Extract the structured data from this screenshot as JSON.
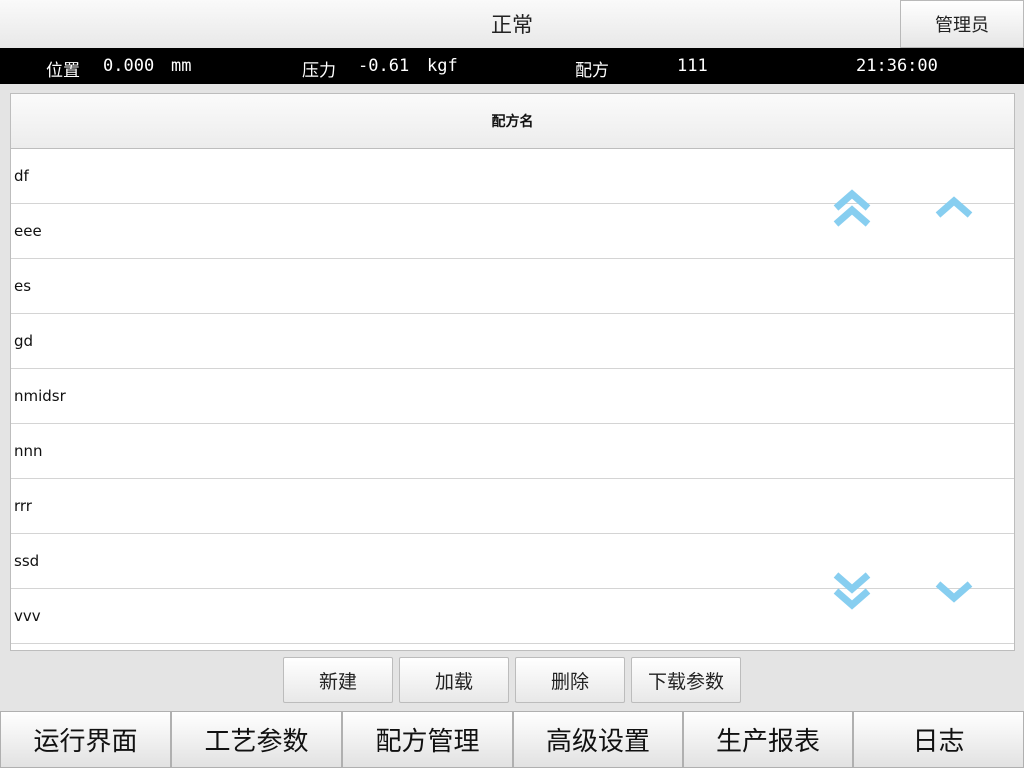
{
  "header": {
    "title": "正常",
    "user_button": "管理员"
  },
  "status": {
    "position_label": "位置",
    "position_value": "0.000",
    "position_unit": "mm",
    "pressure_label": "压力",
    "pressure_value": "-0.61",
    "pressure_unit": "kgf",
    "recipe_label": "配方",
    "recipe_value": "111",
    "time": "21:36:00"
  },
  "table": {
    "column_header": "配方名",
    "rows": [
      "df",
      "eee",
      "es",
      "gd",
      "nmidsr",
      "nnn",
      "rrr",
      "ssd",
      "vvv"
    ]
  },
  "icons": {
    "page_up": "double-chevron-up-icon",
    "line_up": "chevron-up-icon",
    "page_down": "double-chevron-down-icon",
    "line_down": "chevron-down-icon",
    "accent": "#87cef0"
  },
  "actions": {
    "new": "新建",
    "load": "加载",
    "delete": "删除",
    "download": "下载参数"
  },
  "nav": {
    "run": "运行界面",
    "process": "工艺参数",
    "recipe": "配方管理",
    "advanced": "高级设置",
    "report": "生产报表",
    "log": "日志"
  }
}
